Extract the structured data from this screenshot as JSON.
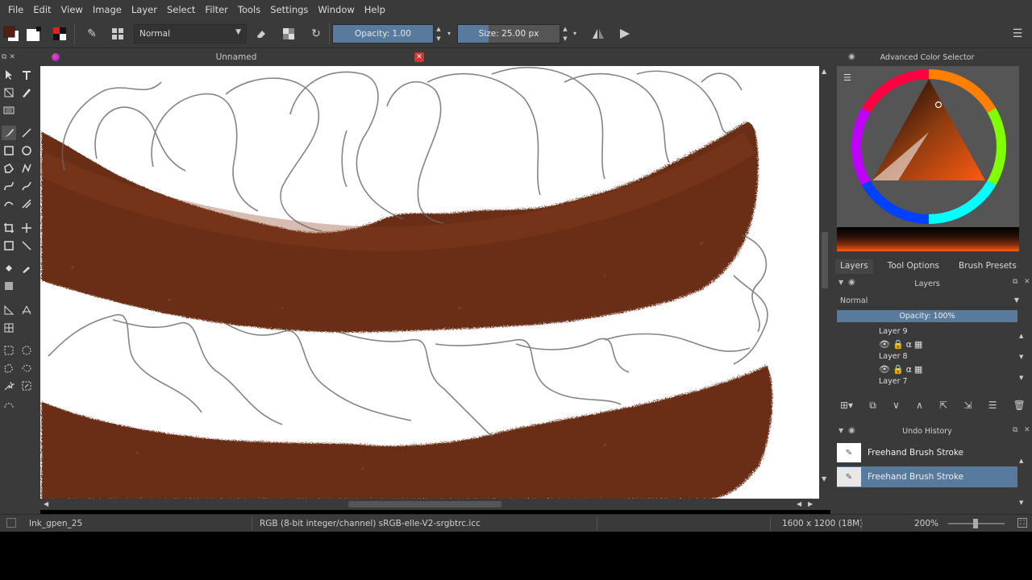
{
  "menu": [
    "File",
    "Edit",
    "View",
    "Image",
    "Layer",
    "Select",
    "Filter",
    "Tools",
    "Settings",
    "Window",
    "Help"
  ],
  "toolbar": {
    "blend_mode": "Normal",
    "opacity_label": "Opacity:  1.00",
    "opacity_value": 1.0,
    "size_label": "Size:  25.00 px",
    "size_value": 25.0
  },
  "document": {
    "title": "Unnamed"
  },
  "dock": {
    "color_selector_title": "Advanced Color Selector",
    "tabs": [
      "Layers",
      "Tool Options",
      "Brush Presets"
    ],
    "layers_title": "Layers",
    "layers_blend": "Normal",
    "layers_opacity": "Opacity:  100%",
    "layers": [
      "Layer 9",
      "Layer 8",
      "Layer 7"
    ],
    "undo_title": "Undo History",
    "history": [
      "Freehand Brush Stroke",
      "Freehand Brush Stroke"
    ]
  },
  "status": {
    "brush": "Ink_gpen_25",
    "color_info": "RGB (8-bit integer/channel)  sRGB-elle-V2-srgbtrc.icc",
    "image_size": "1600 x 1200 (18M)",
    "zoom": "200%"
  },
  "colors": {
    "chrome": "#3a3a3a",
    "accent": "#587a9d",
    "paint": "#6b2e16",
    "close": "#d53434"
  }
}
